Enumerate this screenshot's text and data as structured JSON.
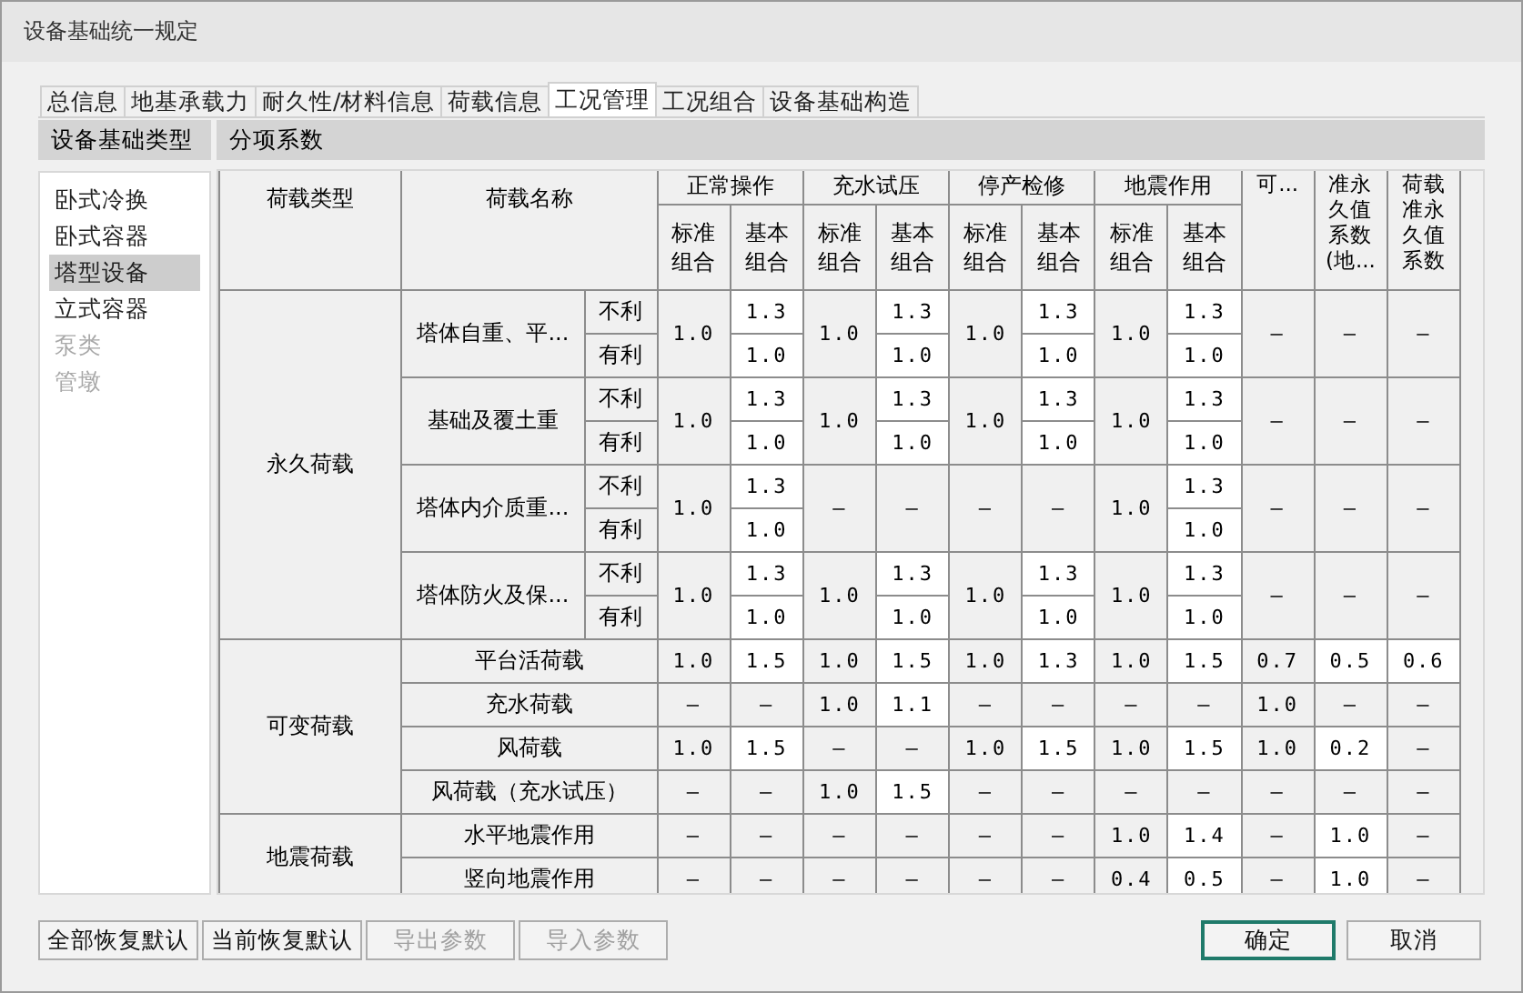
{
  "window": {
    "title": "设备基础统一规定"
  },
  "tabs": [
    {
      "label": "总信息",
      "selected": false
    },
    {
      "label": "地基承载力",
      "selected": false
    },
    {
      "label": "耐久性/材料信息",
      "selected": false
    },
    {
      "label": "荷载信息",
      "selected": false
    },
    {
      "label": "工况管理",
      "selected": true
    },
    {
      "label": "工况组合",
      "selected": false
    },
    {
      "label": "设备基础构造",
      "selected": false
    }
  ],
  "sidebar": {
    "title": "设备基础类型",
    "items": [
      {
        "label": "卧式冷换",
        "selected": false,
        "disabled": false
      },
      {
        "label": "卧式容器",
        "selected": false,
        "disabled": false
      },
      {
        "label": "塔型设备",
        "selected": true,
        "disabled": false
      },
      {
        "label": "立式容器",
        "selected": false,
        "disabled": false
      },
      {
        "label": "泵类",
        "selected": false,
        "disabled": true
      },
      {
        "label": "管墩",
        "selected": false,
        "disabled": true
      }
    ]
  },
  "panel": {
    "title": "分项系数"
  },
  "table": {
    "type_header": "荷载类型",
    "name_header": "荷载名称",
    "column_groups": [
      {
        "label": "正常操作",
        "columns": [
          "标准组合",
          "基本组合"
        ]
      },
      {
        "label": "充水试压",
        "columns": [
          "标准组合",
          "基本组合"
        ]
      },
      {
        "label": "停产检修",
        "columns": [
          "标准组合",
          "基本组合"
        ]
      },
      {
        "label": "地震作用",
        "columns": [
          "标准组合",
          "基本组合"
        ]
      }
    ],
    "extra_columns": [
      "可...",
      "准永久值系数(地...",
      "荷载准永久值系数"
    ],
    "groups": [
      {
        "type": "永久荷载",
        "loads": [
          {
            "kind": "split",
            "name": "塔体自重、平...",
            "sub_labels": [
              "不利",
              "有利"
            ],
            "cells": [
              {
                "kind": "merged",
                "text": "1.0"
              },
              {
                "kind": "split",
                "values": [
                  {
                    "text": "1.3",
                    "editable": true
                  },
                  {
                    "text": "1.0",
                    "editable": true
                  }
                ]
              },
              {
                "kind": "merged",
                "text": "1.0"
              },
              {
                "kind": "split",
                "values": [
                  {
                    "text": "1.3",
                    "editable": true
                  },
                  {
                    "text": "1.0",
                    "editable": true
                  }
                ]
              },
              {
                "kind": "merged",
                "text": "1.0"
              },
              {
                "kind": "split",
                "values": [
                  {
                    "text": "1.3",
                    "editable": true
                  },
                  {
                    "text": "1.0",
                    "editable": true
                  }
                ]
              },
              {
                "kind": "merged",
                "text": "1.0"
              },
              {
                "kind": "split",
                "values": [
                  {
                    "text": "1.3",
                    "editable": true
                  },
                  {
                    "text": "1.0",
                    "editable": true
                  }
                ]
              },
              {
                "kind": "merged",
                "text": "–"
              },
              {
                "kind": "merged",
                "text": "–"
              },
              {
                "kind": "merged",
                "text": "–"
              }
            ]
          },
          {
            "kind": "split",
            "name": "基础及覆土重",
            "sub_labels": [
              "不利",
              "有利"
            ],
            "cells": [
              {
                "kind": "merged",
                "text": "1.0"
              },
              {
                "kind": "split",
                "values": [
                  {
                    "text": "1.3",
                    "editable": true
                  },
                  {
                    "text": "1.0",
                    "editable": true
                  }
                ]
              },
              {
                "kind": "merged",
                "text": "1.0"
              },
              {
                "kind": "split",
                "values": [
                  {
                    "text": "1.3",
                    "editable": true
                  },
                  {
                    "text": "1.0",
                    "editable": true
                  }
                ]
              },
              {
                "kind": "merged",
                "text": "1.0"
              },
              {
                "kind": "split",
                "values": [
                  {
                    "text": "1.3",
                    "editable": true
                  },
                  {
                    "text": "1.0",
                    "editable": true
                  }
                ]
              },
              {
                "kind": "merged",
                "text": "1.0"
              },
              {
                "kind": "split",
                "values": [
                  {
                    "text": "1.3",
                    "editable": true
                  },
                  {
                    "text": "1.0",
                    "editable": true
                  }
                ]
              },
              {
                "kind": "merged",
                "text": "–"
              },
              {
                "kind": "merged",
                "text": "–"
              },
              {
                "kind": "merged",
                "text": "–"
              }
            ]
          },
          {
            "kind": "split",
            "name": "塔体内介质重...",
            "sub_labels": [
              "不利",
              "有利"
            ],
            "cells": [
              {
                "kind": "merged",
                "text": "1.0"
              },
              {
                "kind": "split",
                "values": [
                  {
                    "text": "1.3",
                    "editable": true
                  },
                  {
                    "text": "1.0",
                    "editable": true
                  }
                ]
              },
              {
                "kind": "merged",
                "text": "–"
              },
              {
                "kind": "merged",
                "text": "–"
              },
              {
                "kind": "merged",
                "text": "–"
              },
              {
                "kind": "merged",
                "text": "–"
              },
              {
                "kind": "merged",
                "text": "1.0"
              },
              {
                "kind": "split",
                "values": [
                  {
                    "text": "1.3",
                    "editable": true
                  },
                  {
                    "text": "1.0",
                    "editable": true
                  }
                ]
              },
              {
                "kind": "merged",
                "text": "–"
              },
              {
                "kind": "merged",
                "text": "–"
              },
              {
                "kind": "merged",
                "text": "–"
              }
            ]
          },
          {
            "kind": "split",
            "name": "塔体防火及保...",
            "sub_labels": [
              "不利",
              "有利"
            ],
            "cells": [
              {
                "kind": "merged",
                "text": "1.0"
              },
              {
                "kind": "split",
                "values": [
                  {
                    "text": "1.3",
                    "editable": true
                  },
                  {
                    "text": "1.0",
                    "editable": true
                  }
                ]
              },
              {
                "kind": "merged",
                "text": "1.0"
              },
              {
                "kind": "split",
                "values": [
                  {
                    "text": "1.3",
                    "editable": true
                  },
                  {
                    "text": "1.0",
                    "editable": true
                  }
                ]
              },
              {
                "kind": "merged",
                "text": "1.0"
              },
              {
                "kind": "split",
                "values": [
                  {
                    "text": "1.3",
                    "editable": true
                  },
                  {
                    "text": "1.0",
                    "editable": true
                  }
                ]
              },
              {
                "kind": "merged",
                "text": "1.0"
              },
              {
                "kind": "split",
                "values": [
                  {
                    "text": "1.3",
                    "editable": true
                  },
                  {
                    "text": "1.0",
                    "editable": true
                  }
                ]
              },
              {
                "kind": "merged",
                "text": "–"
              },
              {
                "kind": "merged",
                "text": "–"
              },
              {
                "kind": "merged",
                "text": "–"
              }
            ]
          }
        ]
      },
      {
        "type": "可变荷载",
        "loads": [
          {
            "kind": "single",
            "name": "平台活荷载",
            "cells": [
              {
                "text": "1.0",
                "editable": false
              },
              {
                "text": "1.5",
                "editable": true
              },
              {
                "text": "1.0",
                "editable": false
              },
              {
                "text": "1.5",
                "editable": true
              },
              {
                "text": "1.0",
                "editable": false
              },
              {
                "text": "1.3",
                "editable": true
              },
              {
                "text": "1.0",
                "editable": false
              },
              {
                "text": "1.5",
                "editable": true
              },
              {
                "text": "0.7",
                "editable": false
              },
              {
                "text": "0.5",
                "editable": true
              },
              {
                "text": "0.6",
                "editable": true
              }
            ]
          },
          {
            "kind": "single",
            "name": "充水荷载",
            "cells": [
              {
                "text": "–",
                "editable": false
              },
              {
                "text": "–",
                "editable": false
              },
              {
                "text": "1.0",
                "editable": false
              },
              {
                "text": "1.1",
                "editable": true
              },
              {
                "text": "–",
                "editable": false
              },
              {
                "text": "–",
                "editable": false
              },
              {
                "text": "–",
                "editable": false
              },
              {
                "text": "–",
                "editable": false
              },
              {
                "text": "1.0",
                "editable": false
              },
              {
                "text": "–",
                "editable": false
              },
              {
                "text": "–",
                "editable": false
              }
            ]
          },
          {
            "kind": "single",
            "name": "风荷载",
            "cells": [
              {
                "text": "1.0",
                "editable": false
              },
              {
                "text": "1.5",
                "editable": true
              },
              {
                "text": "–",
                "editable": false
              },
              {
                "text": "–",
                "editable": false
              },
              {
                "text": "1.0",
                "editable": false
              },
              {
                "text": "1.5",
                "editable": true
              },
              {
                "text": "1.0",
                "editable": false
              },
              {
                "text": "1.5",
                "editable": true
              },
              {
                "text": "1.0",
                "editable": false
              },
              {
                "text": "0.2",
                "editable": true
              },
              {
                "text": "–",
                "editable": false
              }
            ]
          },
          {
            "kind": "single",
            "name": "风荷载（充水试压）",
            "cells": [
              {
                "text": "–",
                "editable": false
              },
              {
                "text": "–",
                "editable": false
              },
              {
                "text": "1.0",
                "editable": false
              },
              {
                "text": "1.5",
                "editable": true
              },
              {
                "text": "–",
                "editable": false
              },
              {
                "text": "–",
                "editable": false
              },
              {
                "text": "–",
                "editable": false
              },
              {
                "text": "–",
                "editable": false
              },
              {
                "text": "–",
                "editable": false
              },
              {
                "text": "–",
                "editable": false
              },
              {
                "text": "–",
                "editable": false
              }
            ]
          }
        ]
      },
      {
        "type": "地震荷载",
        "loads": [
          {
            "kind": "single",
            "name": "水平地震作用",
            "cells": [
              {
                "text": "–",
                "editable": false
              },
              {
                "text": "–",
                "editable": false
              },
              {
                "text": "–",
                "editable": false
              },
              {
                "text": "–",
                "editable": false
              },
              {
                "text": "–",
                "editable": false
              },
              {
                "text": "–",
                "editable": false
              },
              {
                "text": "1.0",
                "editable": false
              },
              {
                "text": "1.4",
                "editable": true
              },
              {
                "text": "–",
                "editable": false
              },
              {
                "text": "1.0",
                "editable": true
              },
              {
                "text": "–",
                "editable": false
              }
            ]
          },
          {
            "kind": "single",
            "name": "竖向地震作用",
            "cells": [
              {
                "text": "–",
                "editable": false
              },
              {
                "text": "–",
                "editable": false
              },
              {
                "text": "–",
                "editable": false
              },
              {
                "text": "–",
                "editable": false
              },
              {
                "text": "–",
                "editable": false
              },
              {
                "text": "–",
                "editable": false
              },
              {
                "text": "0.4",
                "editable": false
              },
              {
                "text": "0.5",
                "editable": true
              },
              {
                "text": "–",
                "editable": false
              },
              {
                "text": "1.0",
                "editable": true
              },
              {
                "text": "–",
                "editable": false
              }
            ]
          }
        ]
      }
    ]
  },
  "left_buttons": [
    {
      "label": "全部恢复默认",
      "disabled": false
    },
    {
      "label": "当前恢复默认",
      "disabled": false
    },
    {
      "label": "导出参数",
      "disabled": true
    },
    {
      "label": "导入参数",
      "disabled": true
    }
  ],
  "right_buttons": [
    {
      "label": "确定",
      "default": true
    },
    {
      "label": "取消",
      "default": false
    }
  ]
}
